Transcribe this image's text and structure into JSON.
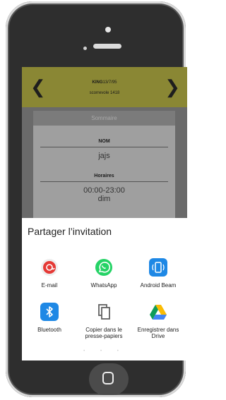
{
  "header": {
    "brand_bold": "KING",
    "brand_rest": "13/7/95",
    "subtitle": "scorrevole 1418",
    "prev_label": "❮",
    "next_label": "❯"
  },
  "card": {
    "title": "Sommaire",
    "nom_label": "NOM",
    "nom_value": "jajs",
    "horaires_label": "Horaires",
    "horaires_value": "00:00-23:00",
    "day_partial": "dim"
  },
  "share": {
    "title": "Partager l’invitation",
    "apps": [
      {
        "label": "E-mail",
        "icon": "email-icon"
      },
      {
        "label": "WhatsApp",
        "icon": "whatsapp-icon"
      },
      {
        "label": "Android Beam",
        "icon": "android-beam-icon"
      },
      {
        "label": "Bluetooth",
        "icon": "bluetooth-icon"
      },
      {
        "label": "Copier dans le presse-papiers",
        "icon": "copy-icon"
      },
      {
        "label": "Enregistrer dans Drive",
        "icon": "drive-icon"
      }
    ],
    "pager": "• • •"
  },
  "colors": {
    "topbar": "#8a8734",
    "email_red": "#e53935",
    "whatsapp_green": "#25d366",
    "beam_blue": "#1e88e5",
    "bluetooth_blue": "#1e88e5"
  }
}
